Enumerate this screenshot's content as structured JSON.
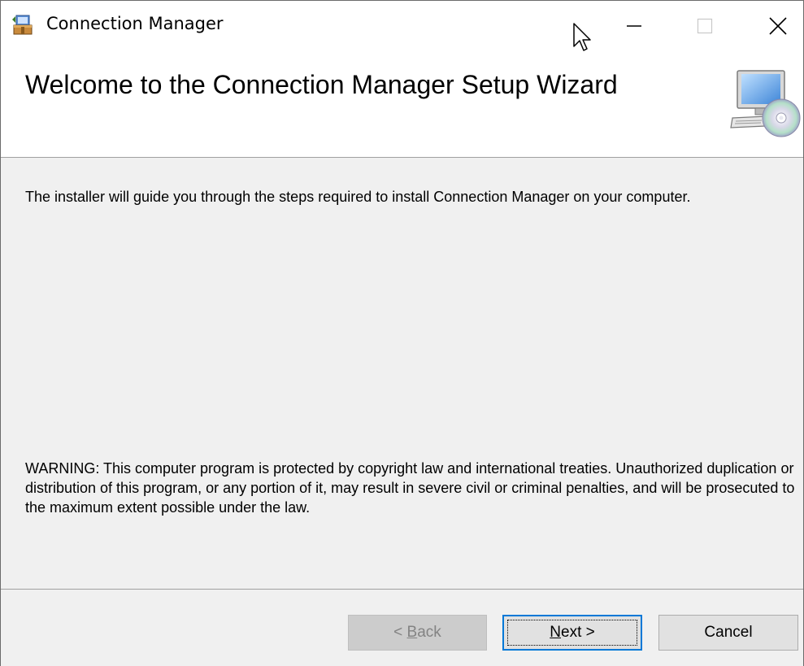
{
  "window": {
    "title": "Connection Manager",
    "icons": {
      "app": "installer-package-icon",
      "minimize": "minimize-icon",
      "maximize": "maximize-icon",
      "close": "close-icon",
      "cursor": "mouse-pointer-icon"
    }
  },
  "banner": {
    "title": "Welcome to the Connection Manager Setup Wizard",
    "icon": "computer-cd-icon"
  },
  "content": {
    "intro": "The installer will guide you through the steps required to install Connection Manager on your computer.",
    "warning": "WARNING: This computer program is protected by copyright law and international treaties. Unauthorized duplication or distribution of this program, or any portion of it, may result in severe civil or criminal penalties, and will be prosecuted to the maximum extent possible under the law."
  },
  "buttons": {
    "back": {
      "prefix": "< ",
      "mnemonic": "B",
      "rest": "ack",
      "enabled": false
    },
    "next": {
      "prefix": "",
      "mnemonic": "N",
      "rest": "ext >",
      "focused": true
    },
    "cancel": {
      "label": "Cancel"
    }
  },
  "colors": {
    "dialog_bg": "#f0f0f0",
    "banner_bg": "#ffffff",
    "focus_border": "#0078d7",
    "disabled_text": "#838383"
  }
}
